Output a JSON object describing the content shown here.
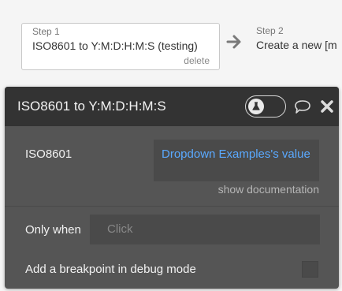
{
  "workflow": {
    "step1": {
      "number_label": "Step 1",
      "name": "ISO8601 to Y:M:D:H:M:S (testing)",
      "delete_label": "delete"
    },
    "step2": {
      "number_label": "Step 2",
      "name": "Create a new [m"
    }
  },
  "action_panel": {
    "title": "ISO8601 to Y:M:D:H:M:S",
    "header_icons": [
      "flask-icon",
      "chat-bubble-icon",
      "close-icon"
    ],
    "fields": {
      "iso_label": "ISO8601",
      "iso_value": "Dropdown Examples's value",
      "show_doc_label": "show documentation",
      "only_when_label": "Only when",
      "only_when_placeholder": "Click",
      "breakpoint_label": "Add a breakpoint in debug mode",
      "breakpoint_checked": false
    }
  },
  "colors": {
    "panel_bg": "#555555",
    "header_bg": "#333333",
    "link_blue": "#5aa9ff"
  }
}
